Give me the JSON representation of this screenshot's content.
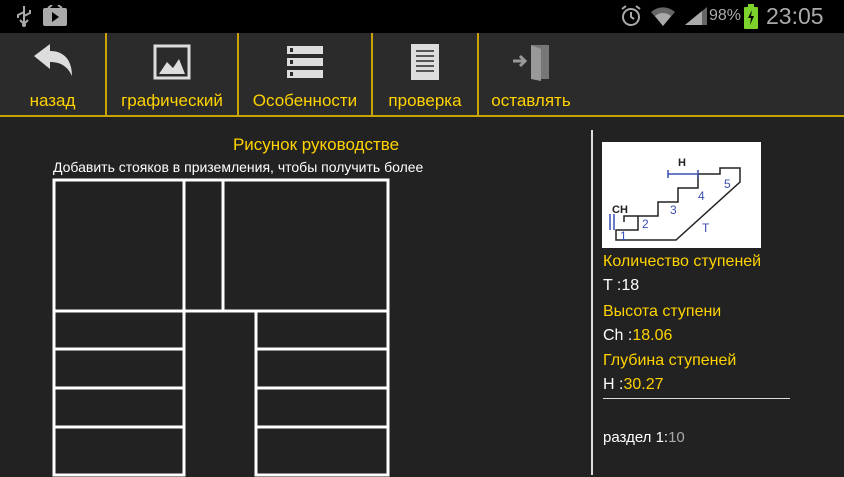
{
  "status_bar": {
    "battery": "98%",
    "time": "23:05"
  },
  "toolbar": {
    "back_label": "назад",
    "graphic_label": "графический",
    "features_label": "Особенности",
    "check_label": "проверка",
    "leave_label": "оставлять"
  },
  "drawing": {
    "title": "Рисунок руководстве",
    "hint": "Добавить стояков в приземления, чтобы получить более"
  },
  "diagram": {
    "h_label": "H",
    "ch_label": "CH",
    "t_label": "T",
    "steps": [
      "1",
      "2",
      "3",
      "4",
      "5"
    ]
  },
  "info": {
    "steps_count_label": "Количество ступеней",
    "steps_count_prefix": "T :",
    "steps_count_value": "18",
    "step_height_label": "Высота ступени",
    "step_height_prefix": "Ch :",
    "step_height_value": "18.06",
    "step_depth_label": "Глубина ступеней",
    "step_depth_prefix": "H :",
    "step_depth_value": "30.27",
    "section_label": "раздел 1:",
    "section_value": "10"
  },
  "colors": {
    "accent": "#ffd300",
    "background": "#222222",
    "toolbar": "#2b2b2b",
    "lines": "#ffffff"
  }
}
